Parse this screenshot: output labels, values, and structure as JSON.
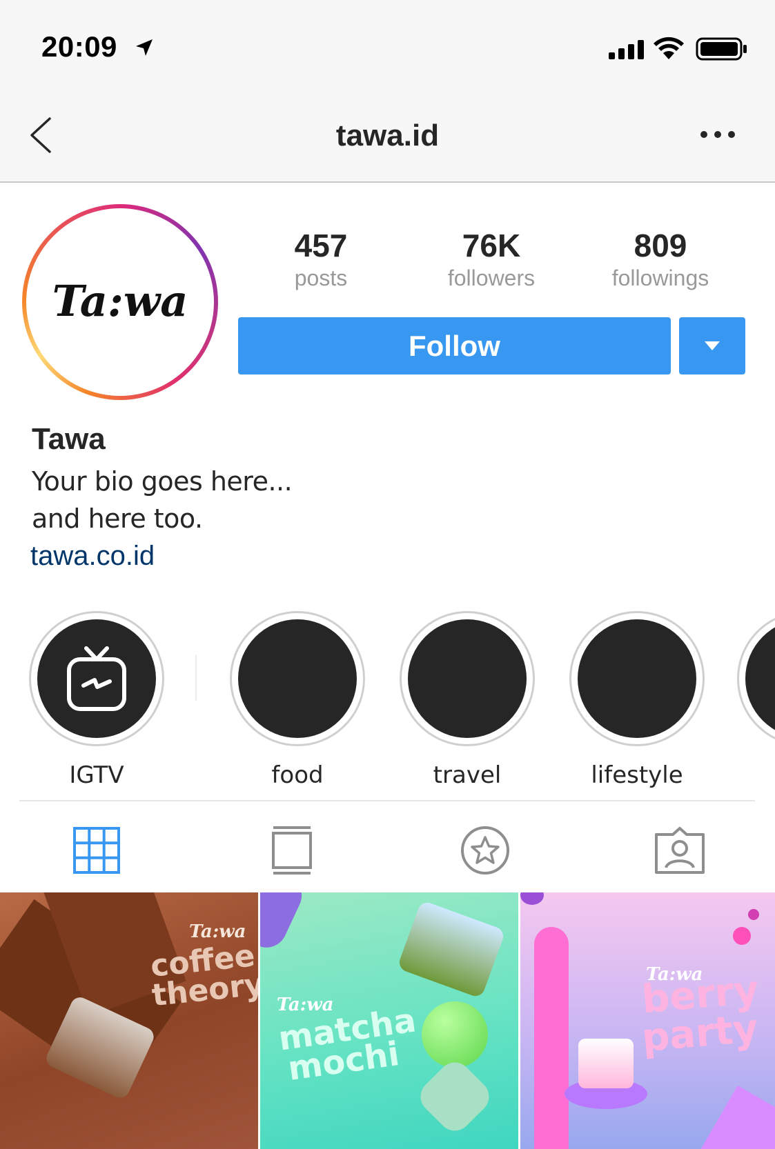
{
  "status_bar": {
    "time": "20:09"
  },
  "nav": {
    "title": "tawa.id"
  },
  "profile": {
    "stats": [
      {
        "value": "457",
        "label": "posts"
      },
      {
        "value": "76K",
        "label": "followers"
      },
      {
        "value": "809",
        "label": "followings"
      }
    ],
    "follow_label": "Follow",
    "display_name": "Tawa",
    "bio_lines": [
      "Your bio goes here...",
      "and here too."
    ],
    "link": "tawa.co.id",
    "avatar_logo_text": "Ta:wa"
  },
  "highlights": [
    {
      "label": "IGTV",
      "icon": "igtv-icon"
    },
    {
      "label": "food"
    },
    {
      "label": "travel"
    },
    {
      "label": "lifestyle"
    }
  ],
  "tabs": [
    {
      "name": "grid",
      "icon": "grid-icon",
      "active": true
    },
    {
      "name": "feed",
      "icon": "feed-icon",
      "active": false
    },
    {
      "name": "saved",
      "icon": "star-icon",
      "active": false
    },
    {
      "name": "tagged",
      "icon": "tagged-user-icon",
      "active": false
    }
  ],
  "posts": [
    {
      "brand": "Ta:wa",
      "line1": "coffee",
      "line2": "theory"
    },
    {
      "brand": "Ta:wa",
      "line1": "matcha",
      "line2": "mochi"
    },
    {
      "brand": "Ta:wa",
      "line1": "berry",
      "line2": "party"
    }
  ],
  "colors": {
    "follow_blue": "#3897f0",
    "link_blue": "#003569",
    "text_dark": "#262626",
    "text_muted": "#999999",
    "tab_active": "#3897f0"
  }
}
